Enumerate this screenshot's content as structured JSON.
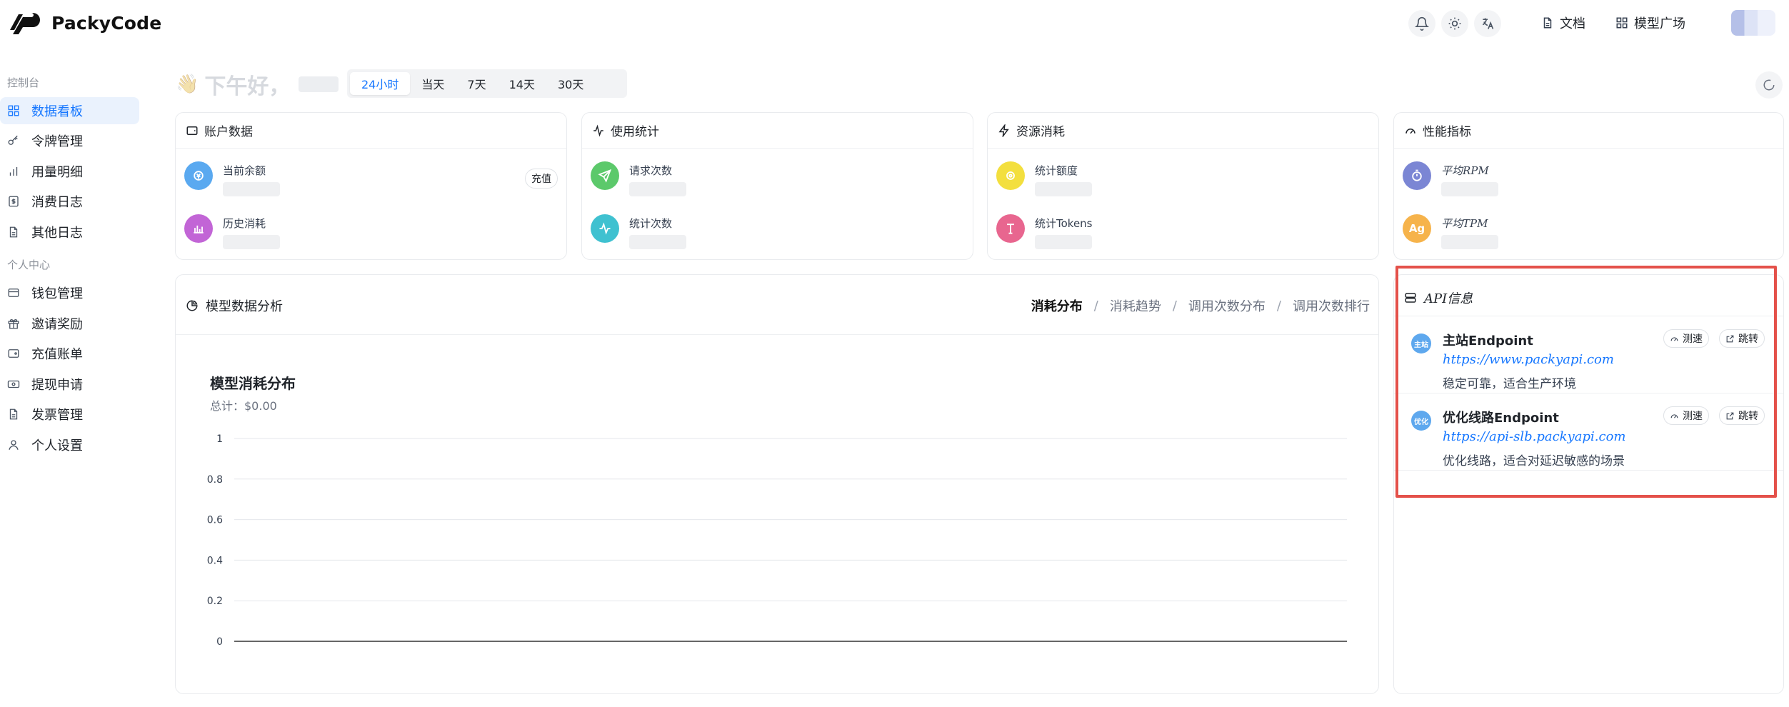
{
  "app": {
    "name": "PackyCode"
  },
  "header": {
    "icons": [
      "bell-icon",
      "sun-icon",
      "translate-icon"
    ],
    "docs_label": "文档",
    "models_label": "模型广场"
  },
  "sidebar": {
    "sections": [
      {
        "title": "控制台",
        "items": [
          {
            "label": "数据看板",
            "icon": "dashboard-icon",
            "active": true
          },
          {
            "label": "令牌管理",
            "icon": "key-icon"
          },
          {
            "label": "用量明细",
            "icon": "bar-chart-icon"
          },
          {
            "label": "消费日志",
            "icon": "receipt-icon"
          },
          {
            "label": "其他日志",
            "icon": "file-icon"
          }
        ]
      },
      {
        "title": "个人中心",
        "items": [
          {
            "label": "钱包管理",
            "icon": "wallet-icon"
          },
          {
            "label": "邀请奖励",
            "icon": "gift-icon"
          },
          {
            "label": "充值账单",
            "icon": "bill-icon"
          },
          {
            "label": "提现申请",
            "icon": "cash-icon"
          },
          {
            "label": "发票管理",
            "icon": "invoice-icon"
          },
          {
            "label": "个人设置",
            "icon": "user-icon"
          }
        ]
      }
    ]
  },
  "greeting": {
    "text": "下午好，"
  },
  "time_range": {
    "options": [
      "24小时",
      "当天",
      "7天",
      "14天",
      "30天"
    ],
    "selected": "24小时"
  },
  "cards": {
    "account": {
      "title": "账户数据",
      "balance_label": "当前余额",
      "recharge_label": "充值",
      "spent_label": "历史消耗"
    },
    "usage": {
      "title": "使用统计",
      "requests_label": "请求次数",
      "count_label": "统计次数"
    },
    "resource": {
      "title": "资源消耗",
      "quota_label": "统计额度",
      "tokens_label": "统计Tokens"
    },
    "performance": {
      "title": "性能指标",
      "rpm_label": "平均RPM",
      "tpm_label": "平均TPM",
      "tpm_icon_text": "Ag"
    }
  },
  "model_analysis": {
    "title": "模型数据分析",
    "tabs": [
      "消耗分布",
      "消耗趋势",
      "调用次数分布",
      "调用次数排行"
    ],
    "active_tab": "消耗分布",
    "chart_title": "模型消耗分布",
    "chart_total": "总计：$0.00"
  },
  "chart_data": {
    "type": "bar",
    "title": "模型消耗分布",
    "categories": [],
    "values": [],
    "ylim": [
      0,
      1
    ],
    "yticks": [
      "1",
      "0.8",
      "0.6",
      "0.4",
      "0.2",
      "0"
    ],
    "grid": true
  },
  "api_info": {
    "title": "API信息",
    "endpoints": [
      {
        "badge": "主站",
        "name": "主站Endpoint",
        "url": "https://www.packyapi.com",
        "desc": "稳定可靠，适合生产环境",
        "speed_label": "测速",
        "jump_label": "跳转"
      },
      {
        "badge": "优化",
        "name": "优化线路Endpoint",
        "url": "https://api-slb.packyapi.com",
        "desc": "优化线路，适合对延迟敏感的场景",
        "speed_label": "测速",
        "jump_label": "跳转"
      }
    ]
  },
  "colors": {
    "accent": "#1677ff",
    "highlight_border": "#e4514a",
    "balance_icon": "#5aa9f0",
    "spent_icon": "#c265d6",
    "requests_icon": "#5cc96b",
    "count_icon": "#3fc1d0",
    "quota_icon": "#f3df3e",
    "tokens_icon": "#e8668f",
    "rpm_icon": "#7b86d4",
    "tpm_icon": "#f6b34b"
  }
}
